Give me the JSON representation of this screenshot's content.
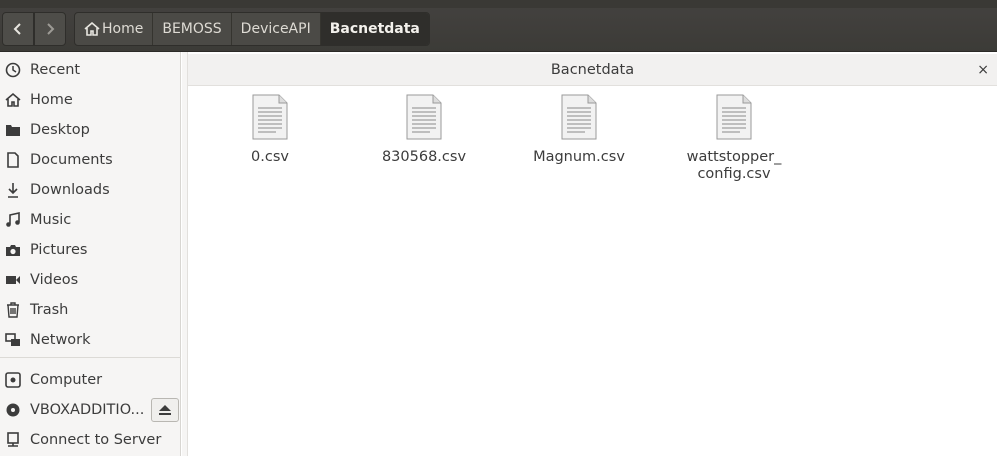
{
  "toolbar": {
    "back_icon": "chevron-left-icon",
    "forward_icon": "chevron-right-icon",
    "breadcrumbs": [
      "Home",
      "BEMOSS",
      "DeviceAPI",
      "Bacnetdata"
    ]
  },
  "sidebar": {
    "items": [
      {
        "label": "Recent",
        "icon": "clock-icon"
      },
      {
        "label": "Home",
        "icon": "home-icon"
      },
      {
        "label": "Desktop",
        "icon": "folder-icon"
      },
      {
        "label": "Documents",
        "icon": "document-icon"
      },
      {
        "label": "Downloads",
        "icon": "download-icon"
      },
      {
        "label": "Music",
        "icon": "music-icon"
      },
      {
        "label": "Pictures",
        "icon": "camera-icon"
      },
      {
        "label": "Videos",
        "icon": "video-icon"
      },
      {
        "label": "Trash",
        "icon": "trash-icon"
      },
      {
        "label": "Network",
        "icon": "network-icon"
      },
      {
        "label": "Computer",
        "icon": "computer-icon"
      },
      {
        "label": "VBOXADDITIO...",
        "icon": "disc-icon"
      },
      {
        "label": "Connect to Server",
        "icon": "server-icon"
      }
    ]
  },
  "main": {
    "title": "Bacnetdata",
    "close": "×",
    "files": [
      {
        "name_line1": "0.csv",
        "name_line2": ""
      },
      {
        "name_line1": "830568.csv",
        "name_line2": ""
      },
      {
        "name_line1": "Magnum.csv",
        "name_line2": ""
      },
      {
        "name_line1": "wattstopper_",
        "name_line2": "config.csv"
      }
    ]
  }
}
